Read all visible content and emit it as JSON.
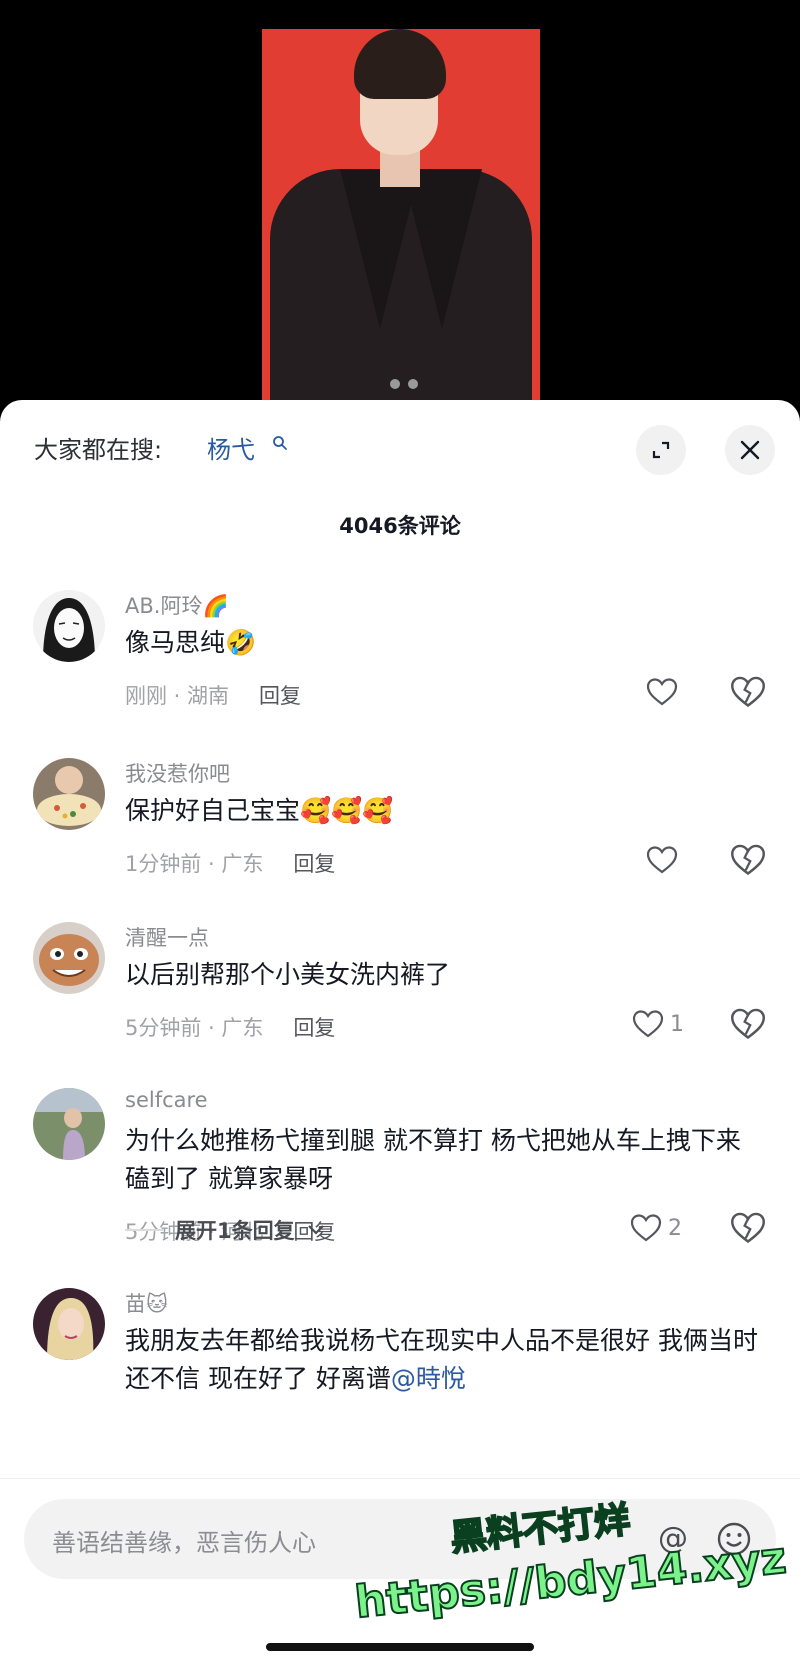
{
  "header": {
    "search_prefix": "大家都在搜:",
    "search_term": "杨弋"
  },
  "comment_count": "4046条评论",
  "comments": [
    {
      "user": "AB.阿玲🌈",
      "text": "像马思纯🤣",
      "meta": "刚刚 · 湖南",
      "reply": "回复",
      "likes": ""
    },
    {
      "user": "我没惹你吧",
      "text": "保护好自己宝宝🥰🥰🥰",
      "meta": "1分钟前 · 广东",
      "reply": "回复",
      "likes": ""
    },
    {
      "user": "清醒一点",
      "text": "以后别帮那个小美女洗内裤了",
      "meta": "5分钟前 · 广东",
      "reply": "回复",
      "likes": "1"
    },
    {
      "user": "selfcare",
      "text": "为什么她推杨弋撞到腿 就不算打 杨弋把她从车上拽下来磕到了 就算家暴呀",
      "meta": "5分钟前 · 河北",
      "reply": "回复",
      "likes": "2"
    },
    {
      "user": "苗🐱",
      "text": "我朋友去年都给我说杨弋在现实中人品不是很好 我俩当时还不信 现在好了 好离谱",
      "mention": "@時悅",
      "meta": "",
      "reply": "",
      "likes": ""
    }
  ],
  "expand_replies": "展开1条回复",
  "input": {
    "placeholder": "善语结善缘，恶言伤人心",
    "at_symbol": "@"
  },
  "watermark": {
    "line1": "黑料不打烊",
    "line2": "https://bdy14.xyz"
  },
  "icons": {
    "search": "search-icon",
    "expand": "expand-icon",
    "close": "close-icon",
    "like": "heart-icon",
    "dislike": "broken-heart-icon",
    "emoji": "emoji-icon"
  },
  "colors": {
    "link_blue": "#2c5aa0",
    "video_background": "#e23d33",
    "watermark_green": "#7cf38a"
  }
}
